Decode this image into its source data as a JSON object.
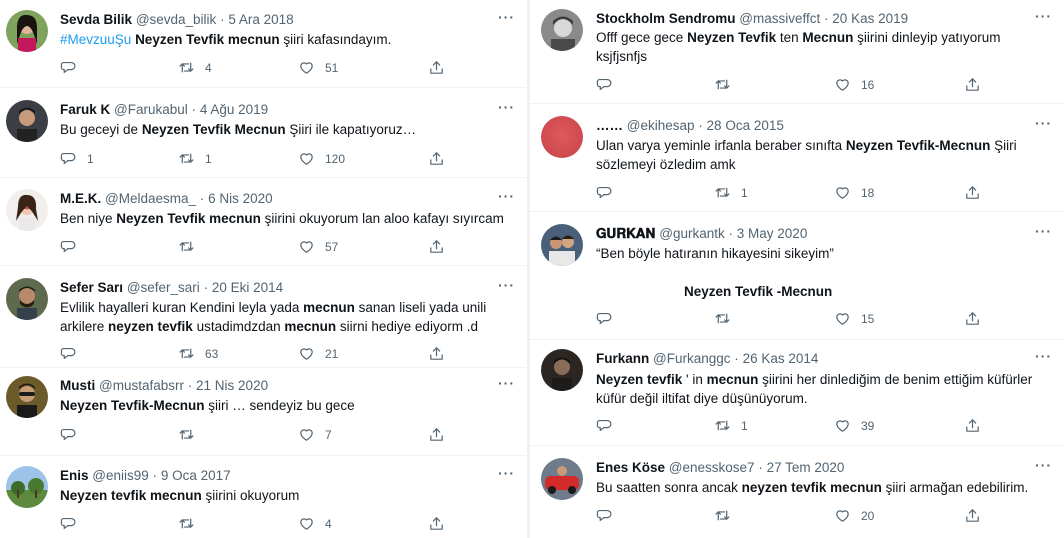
{
  "tweets": [
    {
      "name": "Sevda Bilik",
      "handle": "@sevda_bilik",
      "date": "5 Ara 2018",
      "replies": "",
      "retweets": "4",
      "likes": "51"
    },
    {
      "name": "Faruk K",
      "handle": "@Farukabul",
      "date": "4 Ağu 2019",
      "replies": "1",
      "retweets": "1",
      "likes": "120"
    },
    {
      "name": "M.E.K.",
      "handle": "@Meldaesma_",
      "date": "6 Nis 2020",
      "replies": "",
      "retweets": "",
      "likes": "57"
    },
    {
      "name": "Sefer Sarı",
      "handle": "@sefer_sari",
      "date": "20 Eki 2014",
      "replies": "",
      "retweets": "63",
      "likes": "21"
    },
    {
      "name": "Musti",
      "handle": "@mustafabsrr",
      "date": "21 Nis 2020",
      "replies": "",
      "retweets": "",
      "likes": "7"
    },
    {
      "name": "Enis",
      "handle": "@eniis99",
      "date": "9 Oca 2017",
      "replies": "",
      "retweets": "",
      "likes": "4"
    },
    {
      "name": "Stockholm Sendromu",
      "handle": "@massiveffct",
      "date": "20 Kas 2019",
      "replies": "",
      "retweets": "",
      "likes": "16"
    },
    {
      "name": "……",
      "handle": "@ekihesap",
      "date": "28 Oca 2015",
      "replies": "",
      "retweets": "1",
      "likes": "18"
    },
    {
      "name": "𝐆𝐔𝐑𝐊𝐀𝐍",
      "handle": "@gurkantk",
      "date": "3 May 2020",
      "replies": "",
      "retweets": "",
      "likes": "15"
    },
    {
      "name": "Furkann",
      "handle": "@Furkanggc",
      "date": "26 Kas 2014",
      "replies": "",
      "retweets": "1",
      "likes": "39"
    },
    {
      "name": "Enes Köse",
      "handle": "@enesskose7",
      "date": "27 Tem 2020",
      "replies": "",
      "retweets": "",
      "likes": "20"
    }
  ],
  "text": {
    "t0": {
      "a": "#MevzuuŞu",
      "b": " ",
      "c": "Neyzen Tevfik mecnun",
      "d": " şiiri kafasındayım."
    },
    "t1": {
      "a": "Bu geceyi de ",
      "b": "Neyzen Tevfik Mecnun",
      "c": " Şiiri ile kapatıyoruz…"
    },
    "t2": {
      "a": "Ben niye ",
      "b": "Neyzen Tevfik mecnun",
      "c": " şiirini okuyorum lan aloo kafayı sıyırcam"
    },
    "t3": {
      "a": "Evlilik hayalleri kuran Kendini leyla yada ",
      "b": "mecnun",
      "c": " sanan liseli yada unili",
      "d": "arkilere ",
      "e": "neyzen tevfik",
      "f": " ustadimdzdan ",
      "g": "mecnun",
      "h": " siirni hediye ediyorm .d"
    },
    "t4": {
      "a": "Neyzen Tevfik-Mecnun",
      "b": " şiiri … sendeyiz bu gece"
    },
    "t5": {
      "a": "Neyzen tevfik mecnun",
      "b": " şiirini okuyorum"
    },
    "t6": {
      "a": "Offf gece gece ",
      "b": "Neyzen Tevfik",
      "c": " ten ",
      "d": "Mecnun",
      "e": " şiirini dinleyip yatıyorum",
      "f": "ksjfjsnfjs"
    },
    "t7": {
      "a": "Ulan varya yeminle irfanla beraber sınıfta ",
      "b": "Neyzen Tevfik-Mecnun",
      "c": " Şiiri",
      "d": "sözlemeyi özledim amk"
    },
    "t8": {
      "a": "“Ben böyle hatıranın hikayesini sikeyim”",
      "b": "Neyzen Tevfik -Mecnun"
    },
    "t9": {
      "a": "Neyzen tevfik",
      "b": " ' in ",
      "c": "mecnun",
      "d": " şiirini her dinlediğim de benim ettiğim küfürler",
      "e": "küfür değil iltifat diye düşünüyorum."
    },
    "t10": {
      "a": "Bu saatten sonra ancak ",
      "b": "neyzen tevfik mecnun",
      "c": " şiiri armağan edebilirim."
    }
  },
  "ui": {
    "dot": "·",
    "more": "···"
  },
  "colors": {
    "accent": "#1d9bf0",
    "secondary_text": "#536471",
    "border": "#eff3f4"
  },
  "icons": [
    "reply-icon",
    "retweet-icon",
    "like-icon",
    "share-icon",
    "more-icon"
  ]
}
